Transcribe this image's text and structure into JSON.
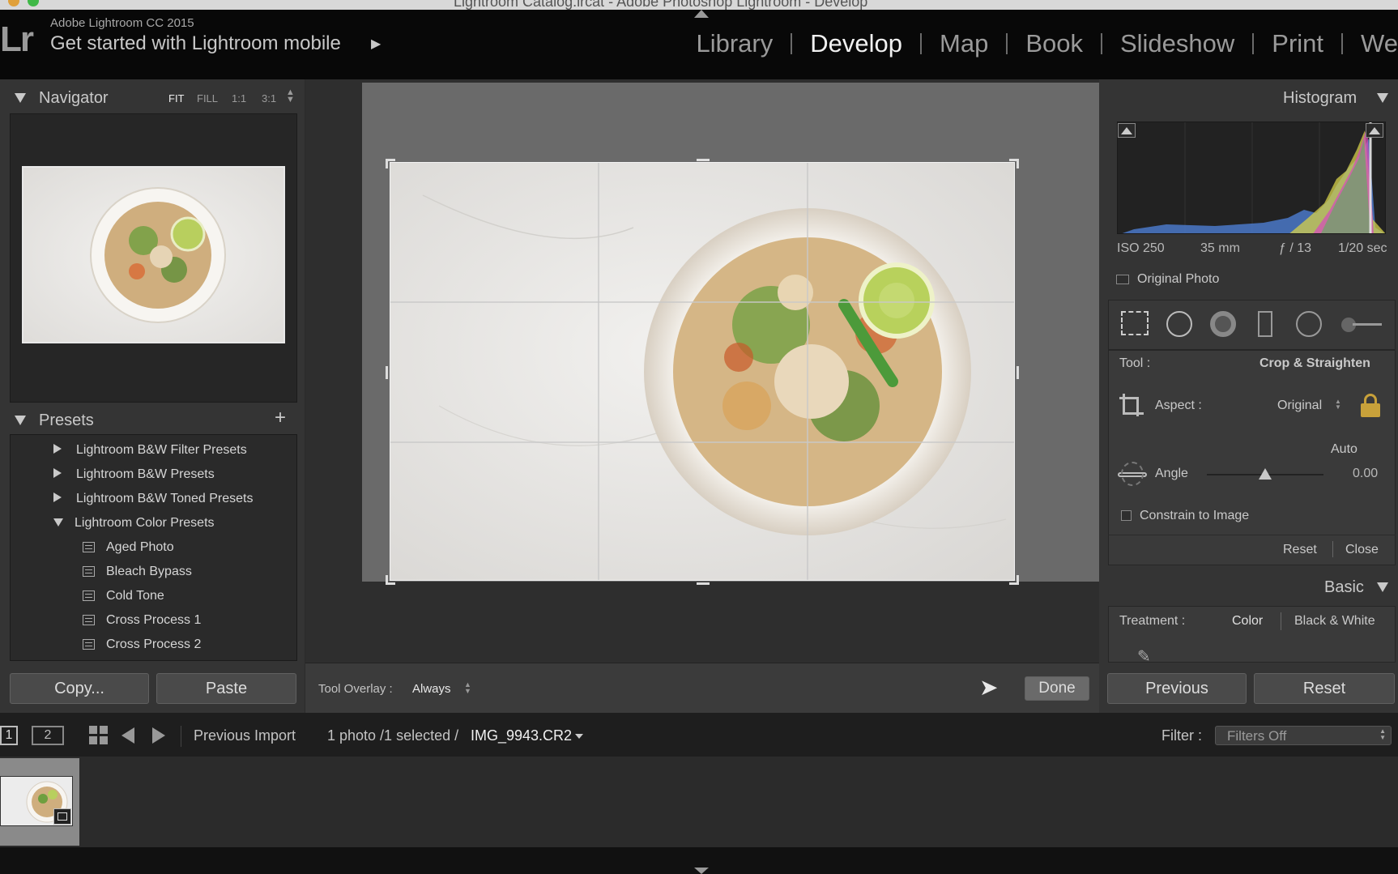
{
  "window": {
    "title": "Lightroom Catalog.lrcat - Adobe Photoshop Lightroom - Develop"
  },
  "identity": {
    "logo": "Lr",
    "product": "Adobe Lightroom CC 2015",
    "tagline": "Get started with Lightroom mobile"
  },
  "modules": [
    {
      "label": "Library",
      "active": false
    },
    {
      "label": "Develop",
      "active": true
    },
    {
      "label": "Map",
      "active": false
    },
    {
      "label": "Book",
      "active": false
    },
    {
      "label": "Slideshow",
      "active": false
    },
    {
      "label": "Print",
      "active": false
    },
    {
      "label": "We",
      "active": false
    }
  ],
  "navigator": {
    "title": "Navigator",
    "zoom": [
      "FIT",
      "FILL",
      "1:1",
      "3:1"
    ],
    "active_zoom": "FIT"
  },
  "presets": {
    "title": "Presets",
    "add": "+",
    "groups": [
      {
        "label": "Lightroom B&W Filter Presets",
        "expanded": false
      },
      {
        "label": "Lightroom B&W Presets",
        "expanded": false
      },
      {
        "label": "Lightroom B&W Toned Presets",
        "expanded": false
      },
      {
        "label": "Lightroom Color Presets",
        "expanded": true
      }
    ],
    "items": [
      "Aged Photo",
      "Bleach Bypass",
      "Cold Tone",
      "Cross Process 1",
      "Cross Process 2"
    ]
  },
  "left_buttons": {
    "copy": "Copy...",
    "paste": "Paste"
  },
  "toolbar": {
    "overlay_label": "Tool Overlay :",
    "overlay_value": "Always",
    "done": "Done"
  },
  "histogram": {
    "title": "Histogram",
    "iso": "ISO 250",
    "focal": "35 mm",
    "aperture": "ƒ / 13",
    "shutter": "1/20 sec",
    "original_photo": "Original Photo"
  },
  "crop": {
    "tool_label": "Tool :",
    "tool_value": "Crop & Straighten",
    "aspect_label": "Aspect :",
    "aspect_value": "Original",
    "auto": "Auto",
    "angle_label": "Angle",
    "angle_value": "0.00",
    "angle_fraction": 0.5,
    "constrain": "Constrain to Image",
    "reset": "Reset",
    "close": "Close"
  },
  "basic": {
    "title": "Basic",
    "treatment_label": "Treatment :",
    "color": "Color",
    "bw": "Black & White"
  },
  "right_buttons": {
    "previous": "Previous",
    "reset": "Reset"
  },
  "filmstrip": {
    "view1": "1",
    "view2": "2",
    "source": "Previous Import",
    "count": "1 photo /1 selected /",
    "filename": "IMG_9943.CR2",
    "filter_label": "Filter :",
    "filter_value": "Filters Off"
  },
  "colors": {
    "accent": "#f0f0f0",
    "panel": "#343434",
    "background": "#2b2b2b",
    "lock": "#c8a13a"
  }
}
